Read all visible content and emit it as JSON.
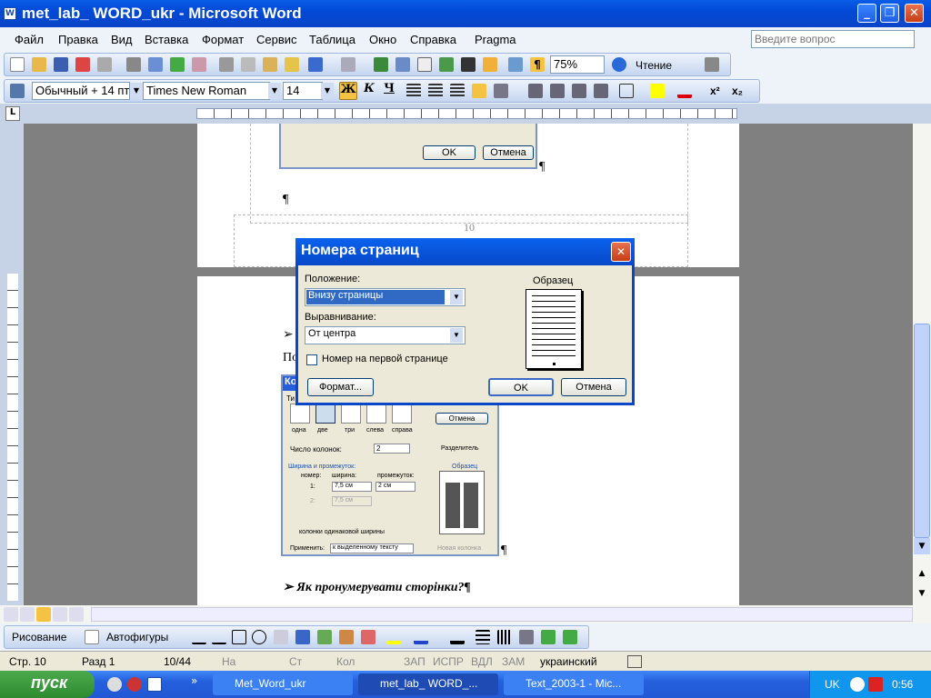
{
  "window": {
    "title": "met_lab_ WORD_ukr - Microsoft Word",
    "app_icon": "W",
    "minimize": "_",
    "maximize": "❐",
    "close": "✕"
  },
  "menu": {
    "items": [
      "Файл",
      "Правка",
      "Вид",
      "Вставка",
      "Формат",
      "Сервис",
      "Таблица",
      "Окно",
      "Справка",
      "Pragma"
    ],
    "help_placeholder": "Введите вопрос"
  },
  "toolbar": {
    "zoom": "75%",
    "reading": "Чтение"
  },
  "format": {
    "style": "Обычный + 14 пт",
    "font": "Times New Roman",
    "size": "14",
    "bold": "Ж",
    "italic": "К",
    "underline": "Ч",
    "superscript": "x²",
    "subscript": "x₂"
  },
  "document": {
    "footer_page": "10",
    "pilcrow": "¶",
    "heading": "Як пронумерувати сторінки?¶",
    "partial_text": "По",
    "bullet": "➢"
  },
  "inner_dialog": {
    "title": "Ко",
    "ok": "OK",
    "cancel": "Отмена",
    "cancel2": "Отмена",
    "type_label": "Ти",
    "presets": [
      "одна",
      "две",
      "три",
      "слева",
      "справа"
    ],
    "cols_label": "Число колонок:",
    "cols_value": "2",
    "separator": "Разделитель",
    "width_section": "Ширина и промежуток:",
    "col_hdr": [
      "номер:",
      "ширина:",
      "промежуток:"
    ],
    "row1": [
      "1:",
      "7,5 см",
      "2 см"
    ],
    "row2": [
      "2:",
      "7,5 см",
      ""
    ],
    "equal": "колонки одинаковой ширины",
    "apply_label": "Применить:",
    "apply_value": "к выделенному тексту",
    "new_col": "Новая колонка",
    "sample": "Образец"
  },
  "dialog": {
    "title": "Номера страниц",
    "position_label": "Положение:",
    "position_value": "Внизу страницы",
    "alignment_label": "Выравнивание:",
    "alignment_value": "От центра",
    "first_page": "Номер на первой странице",
    "sample_label": "Образец",
    "format_button": "Формат...",
    "ok": "OK",
    "cancel": "Отмена",
    "close": "✕"
  },
  "drawing": {
    "draw": "Рисование",
    "autoshapes": "Автофигуры"
  },
  "status": {
    "page": "Стр. 10",
    "section": "Разд 1",
    "pages": "10/44",
    "at": "На",
    "line": "Ст",
    "col": "Кол",
    "rec": "ЗАП",
    "trk": "ИСПР",
    "ext": "ВДЛ",
    "ovr": "ЗАМ",
    "lang": "украинский"
  },
  "taskbar": {
    "start": "пуск",
    "tasks": [
      "Met_Word_ukr",
      "met_lab_ WORD_...",
      "Text_2003-1 - Mic..."
    ],
    "lang": "UK",
    "clock": "0:56",
    "more": "»"
  }
}
